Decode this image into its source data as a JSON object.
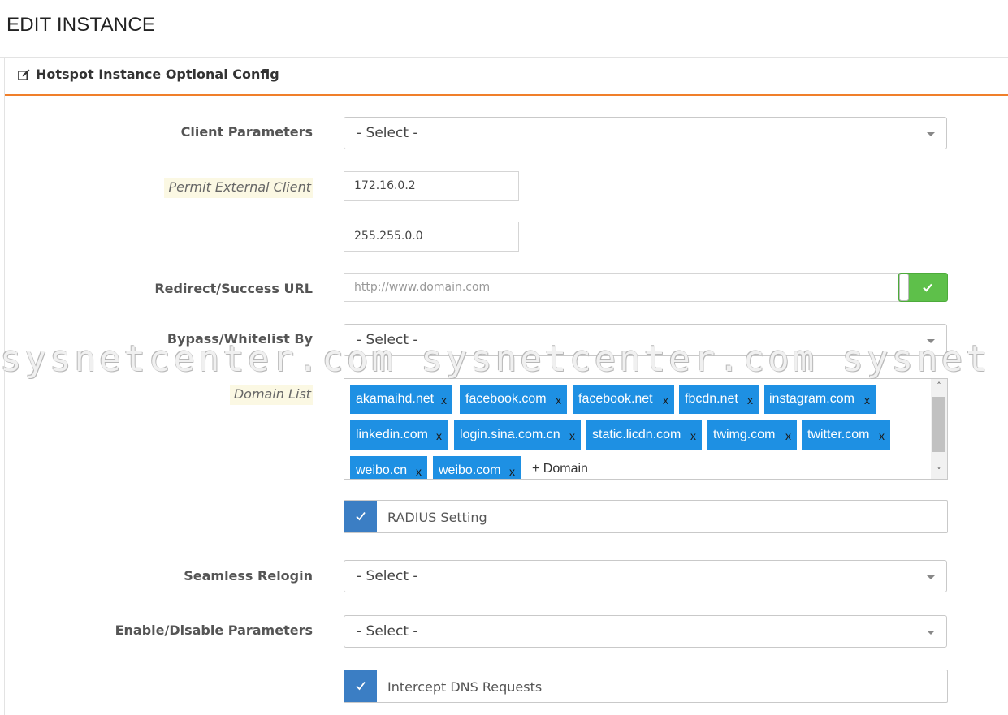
{
  "page": {
    "title": "EDIT INSTANCE"
  },
  "panel": {
    "title": "Hotspot Instance Optional Config"
  },
  "form": {
    "client_parameters": {
      "label": "Client Parameters",
      "value": "- Select -"
    },
    "permit_external_client": {
      "label": "Permit External Client",
      "ip": "172.16.0.2",
      "mask": "255.255.0.0"
    },
    "redirect_url": {
      "label": "Redirect/Success URL",
      "placeholder": "http://www.domain.com",
      "enabled": true
    },
    "bypass_whitelist": {
      "label": "Bypass/Whitelist By",
      "value": "- Select -"
    },
    "domain_list": {
      "label": "Domain List",
      "remove_symbol": "x",
      "add_label": "+ Domain",
      "domains": [
        "akamaihd.net",
        "facebook.com",
        "facebook.net",
        "fbcdn.net",
        "instagram.com",
        "linkedin.com",
        "login.sina.com.cn",
        "static.licdn.com",
        "twimg.com",
        "twitter.com",
        "weibo.cn",
        "weibo.com"
      ]
    },
    "radius_setting": {
      "label": "RADIUS Setting",
      "checked": true
    },
    "seamless_relogin": {
      "label": "Seamless Relogin",
      "value": "- Select -"
    },
    "enable_disable": {
      "label": "Enable/Disable Parameters",
      "value": "- Select -"
    },
    "intercept_dns": {
      "label": "Intercept DNS Requests",
      "checked": true
    }
  },
  "watermark": {
    "text": "sysnetcenter.com sysnetcenter.com sysnet"
  },
  "colors": {
    "accent": "#f07f2a",
    "tag": "#1e90e3",
    "toggle_on": "#5ec04a",
    "checkbox": "#3b7ec4"
  }
}
